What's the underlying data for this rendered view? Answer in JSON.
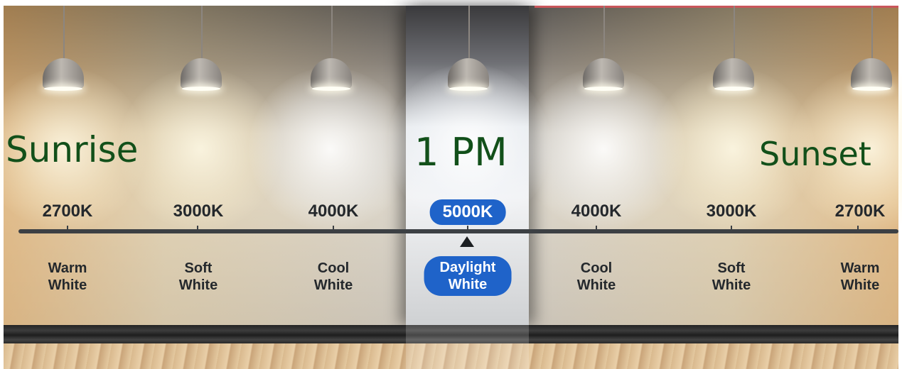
{
  "titles": {
    "left": "Sunrise",
    "center": "1 PM",
    "right": "Sunset"
  },
  "stops": [
    {
      "kelvin": "2700K",
      "label_line1": "Warm",
      "label_line2": "White"
    },
    {
      "kelvin": "3000K",
      "label_line1": "Soft",
      "label_line2": "White"
    },
    {
      "kelvin": "4000K",
      "label_line1": "Cool",
      "label_line2": "White"
    },
    {
      "kelvin": "5000K",
      "label_line1": "Daylight",
      "label_line2": "White"
    },
    {
      "kelvin": "4000K",
      "label_line1": "Cool",
      "label_line2": "White"
    },
    {
      "kelvin": "3000K",
      "label_line1": "Soft",
      "label_line2": "White"
    },
    {
      "kelvin": "2700K",
      "label_line1": "Warm",
      "label_line2": "White"
    }
  ],
  "colors": {
    "title_green": "#12501a",
    "highlight_blue": "#1f63c9",
    "text_dark": "#24282c"
  }
}
